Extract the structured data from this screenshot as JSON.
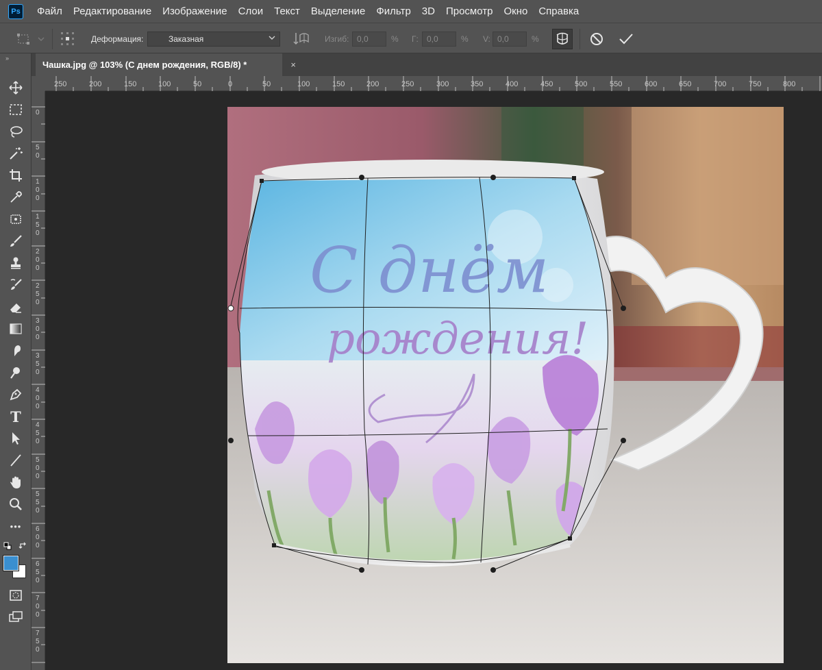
{
  "app": {
    "logo": "Ps"
  },
  "menu": [
    "Файл",
    "Редактирование",
    "Изображение",
    "Слои",
    "Текст",
    "Выделение",
    "Фильтр",
    "3D",
    "Просмотр",
    "Окно",
    "Справка"
  ],
  "options": {
    "deform_label": "Деформация:",
    "deform_value": "Заказная",
    "bend_label": "Изгиб:",
    "bend_value": "0,0",
    "bend_unit": "%",
    "h_label": "Г:",
    "h_value": "0,0",
    "h_unit": "%",
    "v_label": "V:",
    "v_value": "0,0",
    "v_unit": "%"
  },
  "document": {
    "tab_title": "Чашка.jpg @ 103% (С днем рождения, RGB/8) *",
    "close_glyph": "×"
  },
  "ruler": {
    "top": [
      "250",
      "200",
      "150",
      "100",
      "50",
      "0",
      "50",
      "100",
      "150",
      "200",
      "250",
      "300",
      "350",
      "400",
      "450",
      "500",
      "550",
      "600",
      "650",
      "700",
      "750",
      "800"
    ],
    "left": [
      "0",
      "5\n0",
      "1\n0\n0",
      "1\n5\n0",
      "2\n0\n0",
      "2\n5\n0",
      "3\n0\n0",
      "3\n5\n0",
      "4\n0\n0",
      "4\n5\n0",
      "5\n0\n0",
      "5\n5\n0",
      "6\n0\n0",
      "6\n5\n0",
      "7\n0\n0",
      "7\n5\n0"
    ]
  },
  "artwork": {
    "line1": "С днём",
    "line2": "рождения!",
    "colors": {
      "sky": "#8fcde8",
      "lettering": "#7d8fd0",
      "crocus": "#c79be0",
      "mug": "#f2f2f2",
      "accent_fg": "#3a8fd0"
    }
  },
  "toolbar": {
    "icons": [
      "move-icon",
      "marquee-icon",
      "lasso-icon",
      "magic-wand-icon",
      "crop-icon",
      "eyedropper-icon",
      "healing-icon",
      "brush-icon",
      "stamp-icon",
      "history-brush-icon",
      "eraser-icon",
      "gradient-icon",
      "smudge-icon",
      "dodge-icon",
      "pen-icon",
      "type-icon",
      "path-select-icon",
      "line-icon",
      "hand-icon",
      "zoom-icon",
      "more-icon"
    ],
    "type_glyph": "T",
    "more_glyph": "•••"
  }
}
